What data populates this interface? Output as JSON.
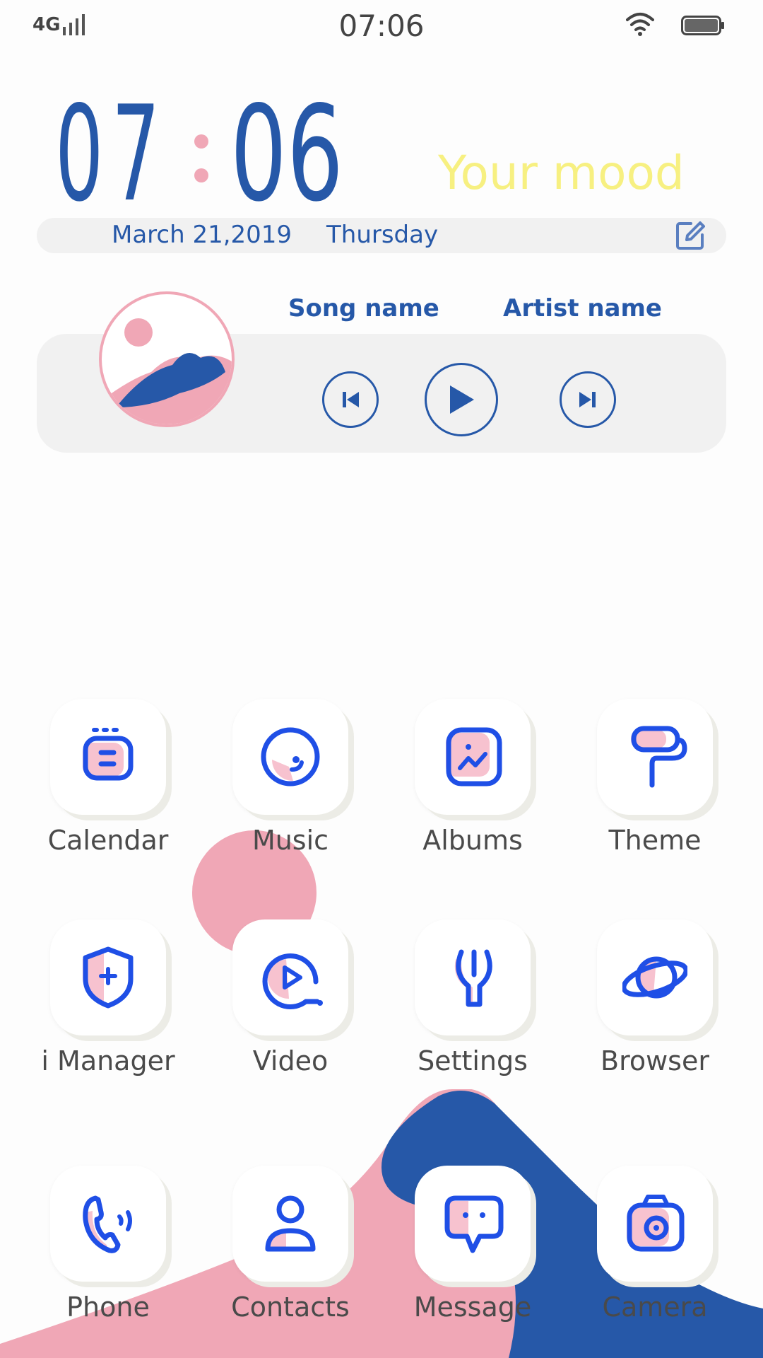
{
  "status_bar": {
    "network": "4G",
    "time": "07:06"
  },
  "clock": {
    "hours": "07",
    "minutes": "06",
    "mood": "Your mood",
    "date": "March 21,2019",
    "day": "Thursday"
  },
  "music": {
    "song": "Song name",
    "artist": "Artist name"
  },
  "apps": [
    {
      "label": "Calendar",
      "icon": "calendar-icon"
    },
    {
      "label": "Music",
      "icon": "music-icon"
    },
    {
      "label": "Albums",
      "icon": "albums-icon"
    },
    {
      "label": "Theme",
      "icon": "theme-icon"
    },
    {
      "label": "i Manager",
      "icon": "shield-icon"
    },
    {
      "label": "Video",
      "icon": "video-icon"
    },
    {
      "label": "Settings",
      "icon": "settings-icon"
    },
    {
      "label": "Browser",
      "icon": "planet-icon"
    },
    {
      "label": "Phone",
      "icon": "phone-icon"
    },
    {
      "label": "Contacts",
      "icon": "contacts-icon"
    },
    {
      "label": "Message",
      "icon": "message-icon"
    },
    {
      "label": "Camera",
      "icon": "camera-icon"
    }
  ],
  "colors": {
    "accent_blue": "#2658a8",
    "icon_blue": "#1f4fe6",
    "pink": "#f0a7b6",
    "mood_yellow": "#f7f081",
    "card_gray": "#f1f1f1"
  }
}
